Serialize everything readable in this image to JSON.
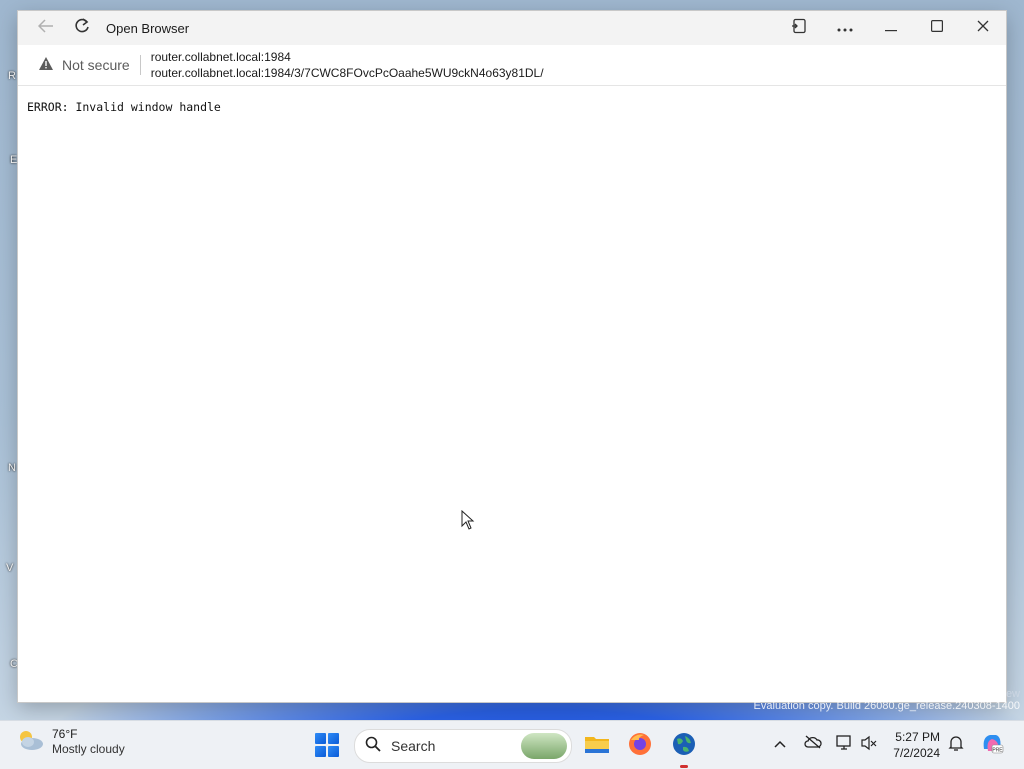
{
  "window": {
    "title": "Open Browser"
  },
  "addressbar": {
    "security_label": "Not secure",
    "origin": "router.collabnet.local:1984",
    "url": "router.collabnet.local:1984/3/7CWC8FOvcPcOaahe5WU9ckN4o63y81DL/"
  },
  "page": {
    "error_text": "ERROR: Invalid window handle"
  },
  "desktop": {
    "watermark": "Evaluation copy. Build 26080.ge_release.240308-1400",
    "watermark_top": "ew"
  },
  "taskbar": {
    "weather_temp": "76°F",
    "weather_desc": "Mostly cloudy",
    "search_label": "Search",
    "time": "5:27 PM",
    "date": "7/2/2024"
  },
  "icons": {
    "back": "arrow-left-icon",
    "refresh": "refresh-icon",
    "warning": "warning-icon",
    "cast": "cast-icon",
    "more": "more-icon",
    "minimize": "minimize-icon",
    "maximize": "maximize-icon",
    "close": "close-icon"
  }
}
